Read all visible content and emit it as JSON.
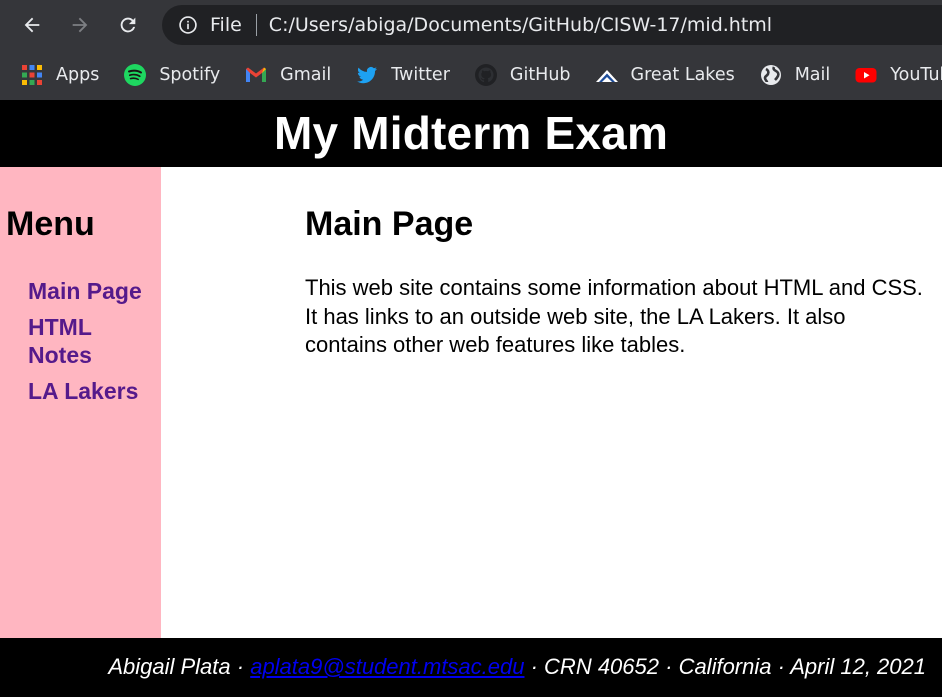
{
  "browser": {
    "info_icon": "info-icon",
    "file_label": "File",
    "url": "C:/Users/abiga/Documents/GitHub/CISW-17/mid.html"
  },
  "bookmarks": [
    {
      "label": "Apps",
      "icon": "apps-grid-icon"
    },
    {
      "label": "Spotify",
      "icon": "spotify-icon"
    },
    {
      "label": "Gmail",
      "icon": "gmail-icon"
    },
    {
      "label": "Twitter",
      "icon": "twitter-icon"
    },
    {
      "label": "GitHub",
      "icon": "github-icon"
    },
    {
      "label": "Great Lakes",
      "icon": "great-lakes-icon"
    },
    {
      "label": "Mail",
      "icon": "globe-icon"
    },
    {
      "label": "YouTube",
      "icon": "youtube-icon"
    }
  ],
  "header": {
    "title": "My Midterm Exam"
  },
  "sidebar": {
    "heading": "Menu",
    "items": [
      {
        "label": "Main Page"
      },
      {
        "label": "HTML Notes"
      },
      {
        "label": "LA Lakers"
      }
    ]
  },
  "main": {
    "heading": "Main Page",
    "paragraph": "This web site contains some information about HTML and CSS. It has links to an outside web site, the LA Lakers. It also contains other web features like tables."
  },
  "footer": {
    "name": "Abigail Plata",
    "email": "aplata9@student.mtsac.edu",
    "crn": "CRN 40652",
    "location": "California",
    "date": "April 12, 2021",
    "separator": " · "
  },
  "colors": {
    "chrome_bg": "#35363a",
    "omnibox_bg": "#202124",
    "header_bg": "#000000",
    "sidebar_bg": "#ffb6c1",
    "menu_link": "#551a8b",
    "footer_link": "#0000ee"
  }
}
